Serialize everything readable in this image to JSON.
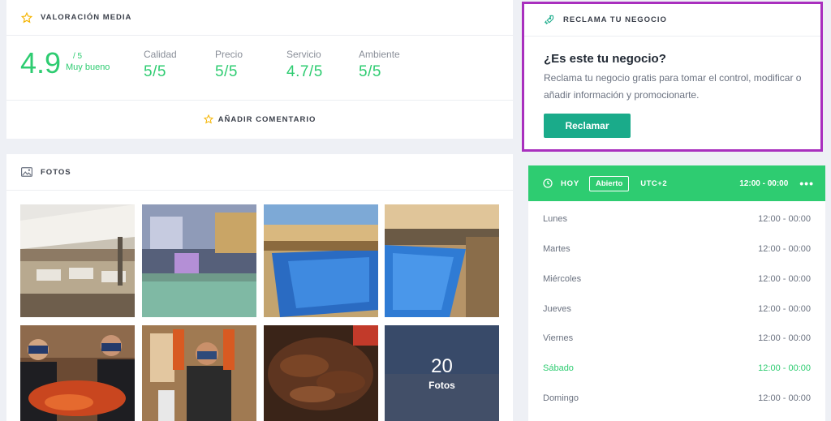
{
  "rating": {
    "title": "VALORACIÓN MEDIA",
    "score": "4.9",
    "max": "/ 5",
    "word": "Muy bueno",
    "metrics": [
      {
        "label": "Calidad",
        "value": "5/5"
      },
      {
        "label": "Precio",
        "value": "5/5"
      },
      {
        "label": "Servicio",
        "value": "4.7/5"
      },
      {
        "label": "Ambiente",
        "value": "5/5"
      }
    ],
    "add_comment": "AÑADIR COMENTARIO",
    "accent": "#2ecc71",
    "star_color": "#f5b400"
  },
  "photos": {
    "title": "FOTOS",
    "more_count": "20",
    "more_label": "Fotos",
    "items": [
      "terrace",
      "pool-night",
      "pool-day",
      "pool-terrace",
      "staff-seafood",
      "chef-lobster",
      "grilled-meat"
    ]
  },
  "claim": {
    "title": "RECLAMA TU NEGOCIO",
    "question": "¿Es este tu negocio?",
    "text": "Reclama tu negocio gratis para tomar el control, modificar o añadir información y promocionarte.",
    "button": "Reclamar",
    "border_color": "#a92fbe",
    "button_color": "#1aab8a"
  },
  "schedule": {
    "today_label": "HOY",
    "status": "Abierto",
    "timezone": "UTC+2",
    "today_hours": "12:00 - 00:00",
    "more": "•••",
    "header_color": "#2ecc71",
    "days": [
      {
        "day": "Lunes",
        "hours": "12:00 - 00:00",
        "today": false
      },
      {
        "day": "Martes",
        "hours": "12:00 - 00:00",
        "today": false
      },
      {
        "day": "Miércoles",
        "hours": "12:00 - 00:00",
        "today": false
      },
      {
        "day": "Jueves",
        "hours": "12:00 - 00:00",
        "today": false
      },
      {
        "day": "Viernes",
        "hours": "12:00 - 00:00",
        "today": false
      },
      {
        "day": "Sábado",
        "hours": "12:00 - 00:00",
        "today": true
      },
      {
        "day": "Domingo",
        "hours": "12:00 - 00:00",
        "today": false
      }
    ]
  }
}
